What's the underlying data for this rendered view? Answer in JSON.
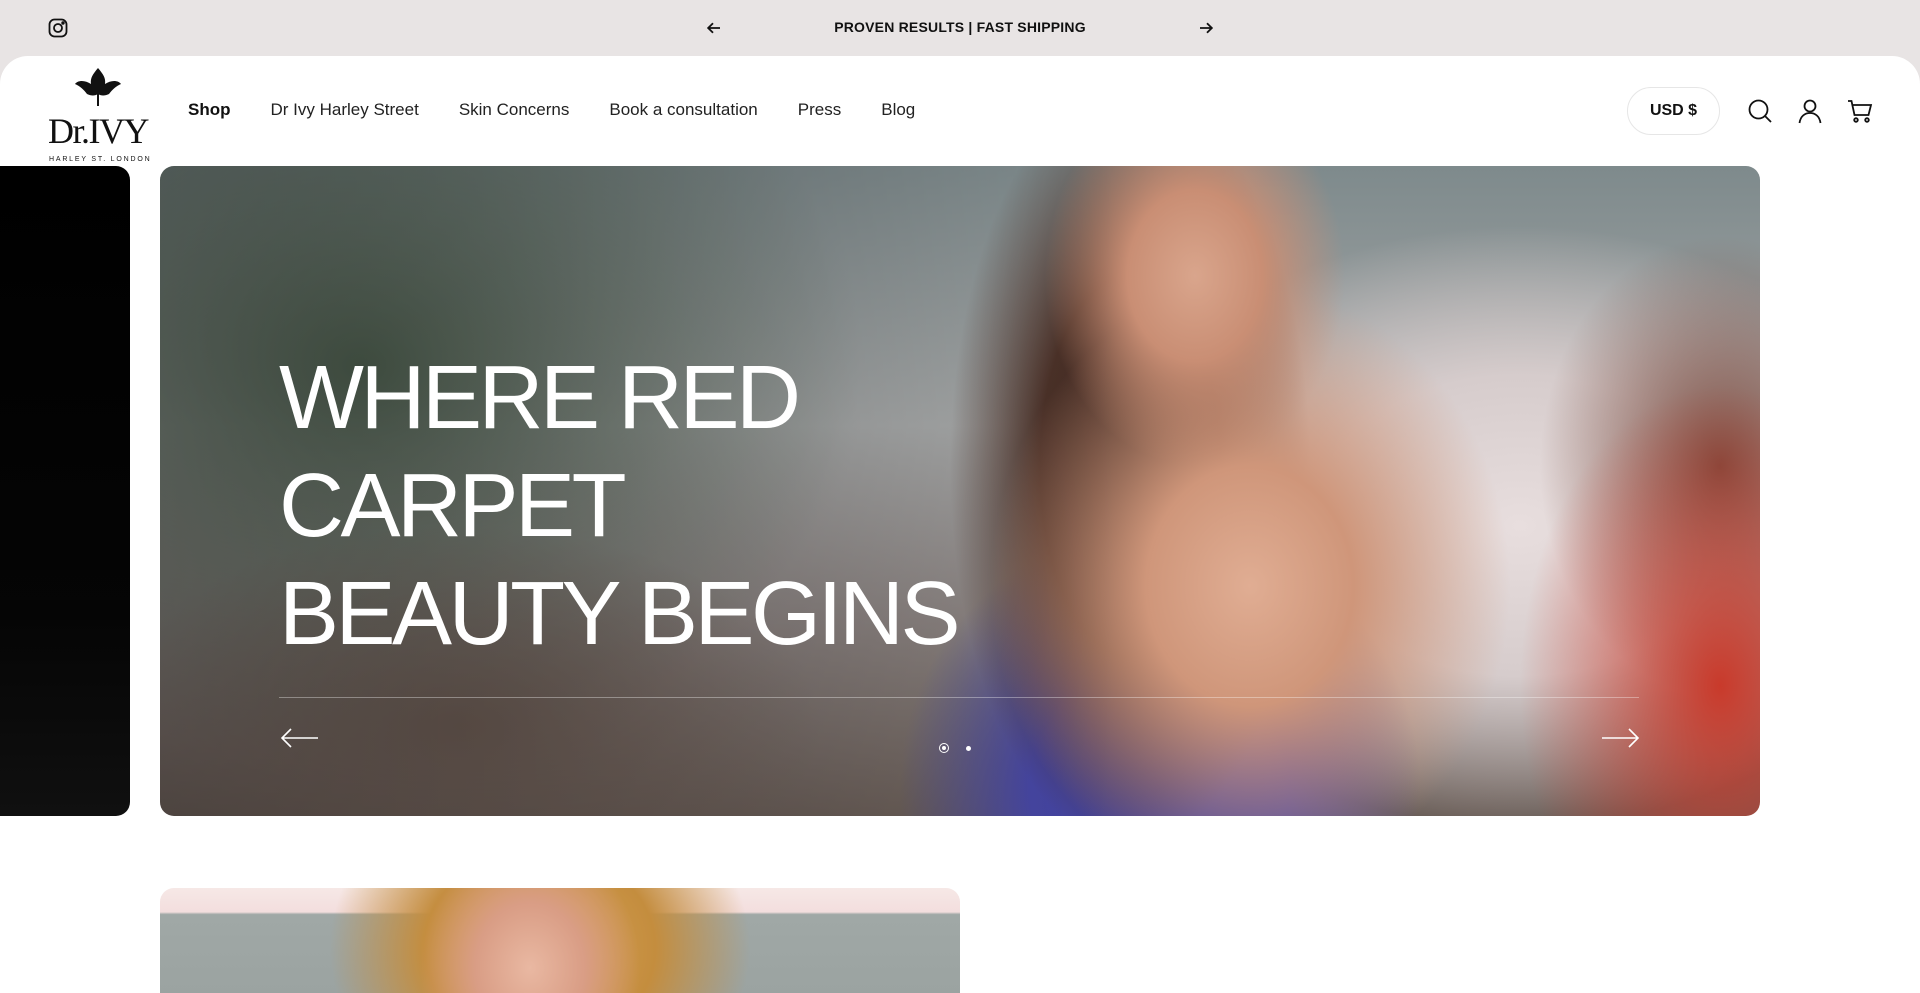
{
  "announcement": {
    "message": "PROVEN RESULTS | FAST SHIPPING",
    "icons": {
      "social": "instagram-icon",
      "prev": "arrow-left-icon",
      "next": "arrow-right-icon"
    }
  },
  "header": {
    "logo": {
      "wordmark": "Dr.IVY",
      "tagline": "HARLEY ST. LONDON",
      "symbol": "ivy-leaf-icon"
    },
    "nav": [
      {
        "label": "Shop",
        "active": true
      },
      {
        "label": "Dr Ivy Harley Street",
        "active": false
      },
      {
        "label": "Skin Concerns",
        "active": false
      },
      {
        "label": "Book a consultation",
        "active": false
      },
      {
        "label": "Press",
        "active": false
      },
      {
        "label": "Blog",
        "active": false
      }
    ],
    "currency": "USD $",
    "icons": [
      "search-icon",
      "account-icon",
      "cart-icon"
    ]
  },
  "hero": {
    "headline_lines": [
      "WHERE RED",
      "CARPET",
      "BEAUTY BEGINS"
    ],
    "slide_count": 2,
    "active_slide": 1,
    "icons": {
      "prev": "long-arrow-left-icon",
      "next": "long-arrow-right-icon"
    }
  },
  "colors": {
    "announcement_bg": "#e8e4e4",
    "page_bg": "#ffffff",
    "text": "#111111",
    "hero_text": "#ffffff"
  }
}
